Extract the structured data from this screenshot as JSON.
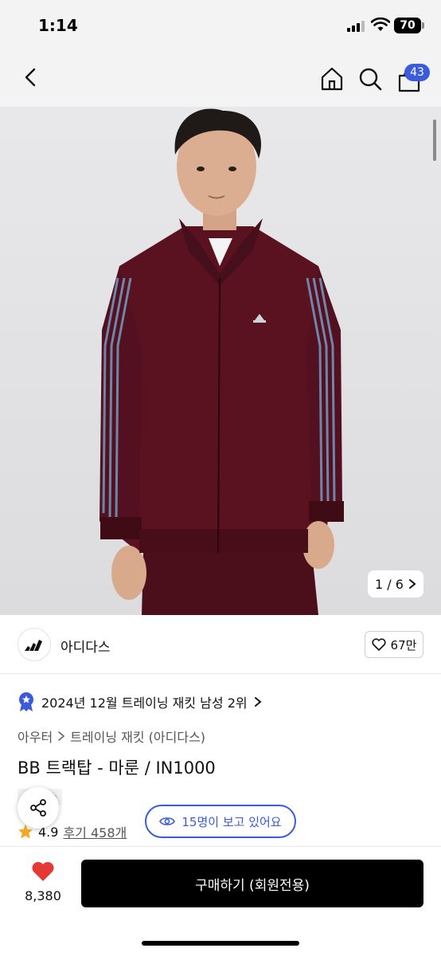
{
  "status_bar": {
    "time": "1:14",
    "battery": "70"
  },
  "header": {
    "cart_count": "43"
  },
  "gallery": {
    "counter": "1 / 6"
  },
  "brand": {
    "name": "아디다스",
    "like_count": "67만"
  },
  "ranking": {
    "text": "2024년 12월 트레이닝 재킷 남성 2위"
  },
  "breadcrumb": {
    "category": "아우터",
    "subcategory": "트레이닝 재킷 (아디다스)"
  },
  "product": {
    "title": "BB 트랙탑 - 마룬 / IN1000",
    "delivery_tag": "배송",
    "rating": "4.9",
    "reviews": "후기 458개",
    "viewers": "15명이 보고 있어요"
  },
  "bottom_bar": {
    "wish_count": "8,380",
    "buy_label": "구매하기 (회원전용)"
  },
  "colors": {
    "accent": "#3b5bdb",
    "heart": "#e53935",
    "jacket": "#5a1220",
    "stripe": "#6e86a8"
  }
}
